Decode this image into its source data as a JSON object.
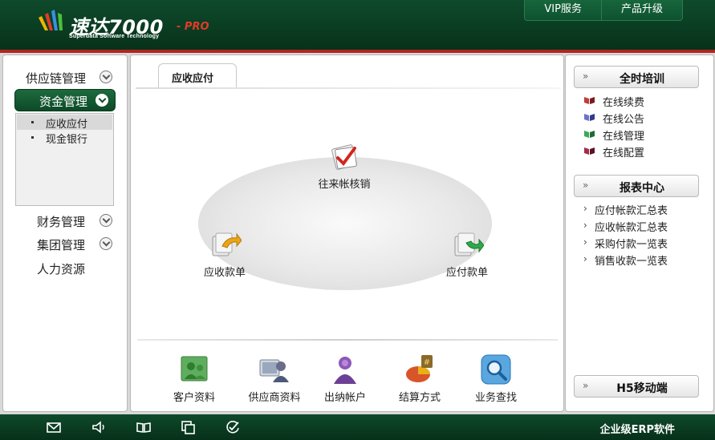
{
  "header": {
    "logo_name": "速达7000",
    "logo_pro": "- PRO",
    "logo_tagline": "Superdata Software Technology",
    "links": [
      "VIP服务",
      "产品升级"
    ]
  },
  "nav": {
    "groups": [
      {
        "label": "供应链管理"
      },
      {
        "label": "资金管理"
      },
      {
        "label": "财务管理"
      },
      {
        "label": "集团管理"
      },
      {
        "label": "人力资源"
      }
    ],
    "sub_items": [
      {
        "label": "应收应付"
      },
      {
        "label": "现金银行"
      }
    ]
  },
  "main": {
    "tab_label": "应收应付",
    "flow": {
      "reconcile": "往来帐核销",
      "receivable": "应收款单",
      "payable": "应付款单"
    },
    "quick": [
      {
        "label": "客户资料"
      },
      {
        "label": "供应商资料"
      },
      {
        "label": "出纳帐户"
      },
      {
        "label": "结算方式"
      },
      {
        "label": "业务查找"
      }
    ]
  },
  "right": {
    "training_title": "全时培训",
    "training_items": [
      "在线续费",
      "在线公告",
      "在线管理",
      "在线配置"
    ],
    "report_title": "报表中心",
    "report_items": [
      "应付帐款汇总表",
      "应收帐款汇总表",
      "采购付款一览表",
      "销售收款一览表"
    ],
    "mobile_title": "H5移动端",
    "arrow_glyph": "»",
    "chev_glyph": "›"
  },
  "footer": {
    "icons": [
      "mail-icon",
      "speaker-icon",
      "book-icon",
      "copy-icon",
      "check-icon"
    ],
    "text": "企业级ERP软件"
  },
  "colors": {
    "header_green": "#0a3d22",
    "header_red_line": "#b0271f",
    "nav_active": "#0c4a27"
  }
}
